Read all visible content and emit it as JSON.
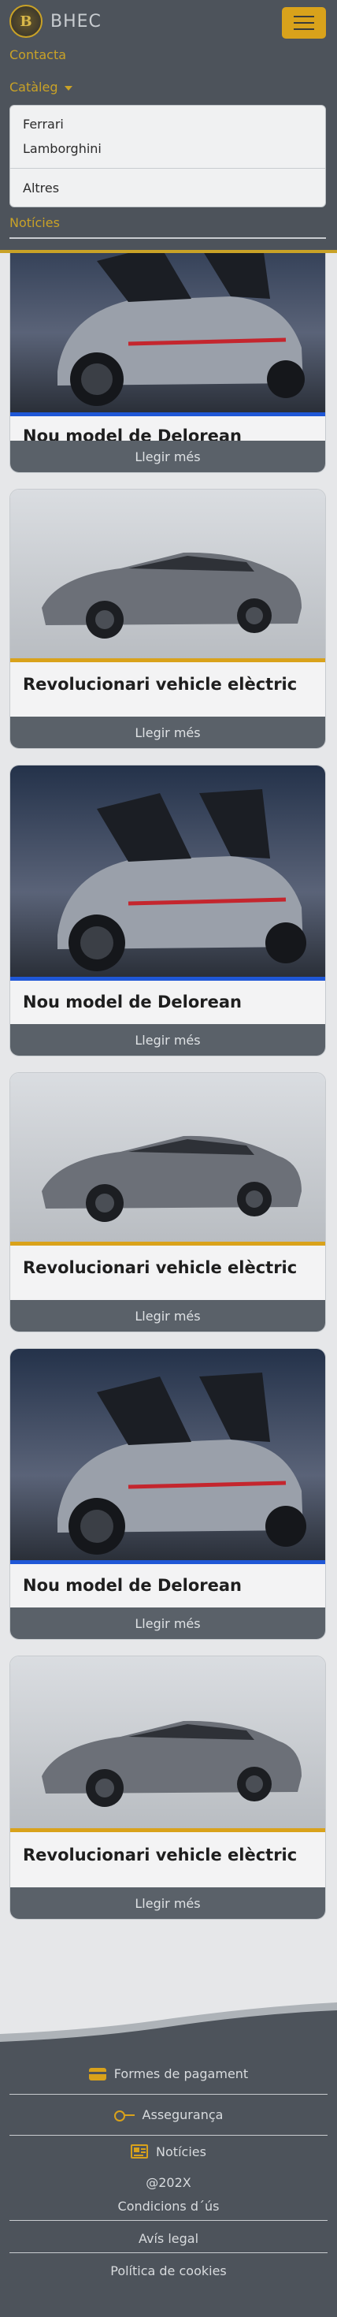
{
  "brand": {
    "name": "BHEC",
    "logo_letter": "B"
  },
  "nav": {
    "contact": "Contacta",
    "catalog": "Catàleg",
    "dropdown": [
      "Ferrari",
      "Lamborghini",
      "Altres"
    ],
    "news": "Notícies"
  },
  "cards": [
    {
      "title": "Nou model de Delorean",
      "button": "Llegir més",
      "accent": "#1f57d6",
      "image": "gullwing-car"
    },
    {
      "title": "Revolucionari vehicle elèctric",
      "button": "Llegir més",
      "accent": "#d9a21b",
      "image": "electric-sedan"
    },
    {
      "title": "Nou model de Delorean",
      "button": "Llegir més",
      "accent": "#1f57d6",
      "image": "gullwing-car"
    },
    {
      "title": "Revolucionari vehicle elèctric",
      "button": "Llegir més",
      "accent": "#d9a21b",
      "image": "electric-sedan"
    },
    {
      "title": "Nou model de Delorean",
      "button": "Llegir més",
      "accent": "#1f57d6",
      "image": "gullwing-car"
    },
    {
      "title": "Revolucionari vehicle elèctric",
      "button": "Llegir més",
      "accent": "#d9a21b",
      "image": "electric-sedan"
    }
  ],
  "footer": {
    "payment": "Formes de pagament",
    "insurance": "Assegurança",
    "news": "Notícies",
    "copyright": "@202X",
    "terms": "Condicions d´ús",
    "legal": "Avís legal",
    "cookies": "Política de cookies"
  },
  "colors": {
    "nav_bg": "#4d535b",
    "gold": "#d9a21b",
    "blue": "#1f57d6",
    "button_bg": "#5a6169"
  }
}
